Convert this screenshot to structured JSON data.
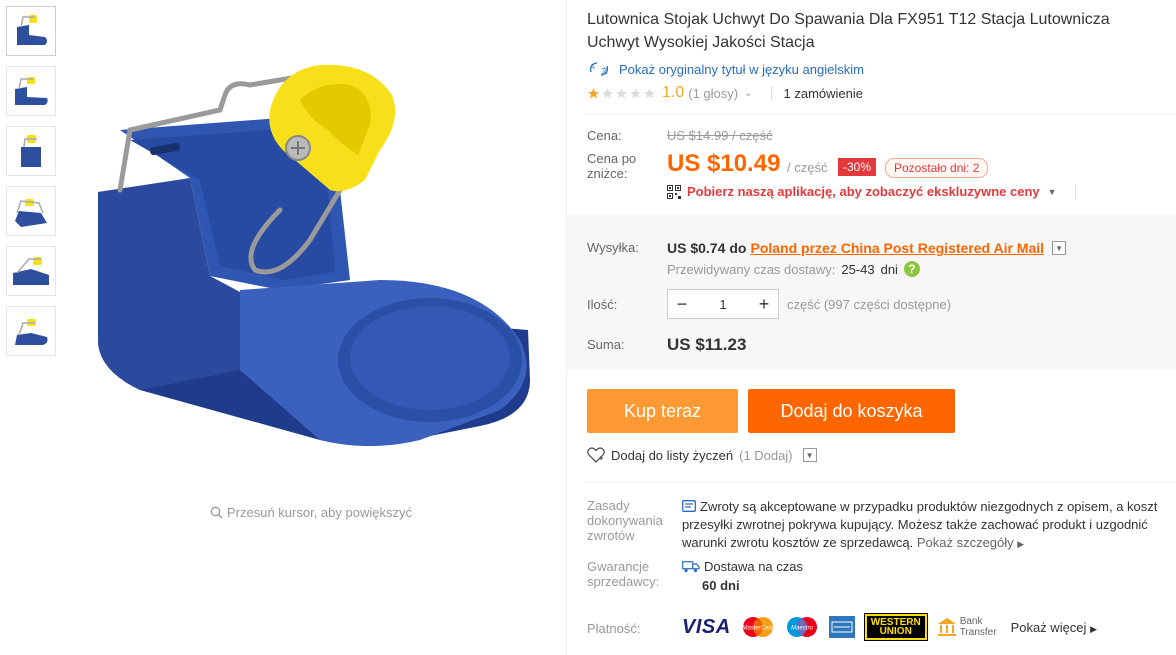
{
  "product": {
    "title": "Lutownica Stojak Uchwyt Do Spawania Dla FX951 T12 Stacja Lutownicza Uchwyt Wysokiej Jakości Stacja",
    "show_original_title": "Pokaż oryginalny tytuł w języku angielskim",
    "rating_value": "1.0",
    "votes": "(1 głosy)",
    "orders": "1 zamówienie",
    "stars_filled": 1,
    "stars_total": 5
  },
  "gallery": {
    "thumbnail_count": 6,
    "zoom_hint": "Przesuń kursor, aby powiększyć"
  },
  "price": {
    "label_price": "Cena:",
    "old_price": "US $14.99 / część",
    "label_discounted": "Cena po zniżce:",
    "new_price": "US $10.49",
    "per_unit": "/ część",
    "discount": "-30%",
    "remaining": "Pozostało dni: 2",
    "app_promo": "Pobierz naszą aplikację, aby zobaczyć ekskluzywne ceny"
  },
  "shipping": {
    "label": "Wysyłka:",
    "cost": "US $0.74",
    "to": "do",
    "method": "Poland przez China Post Registered Air Mail",
    "eta_label": "Przewidywany czas dostawy:",
    "eta_value": "25-43",
    "eta_unit": "dni"
  },
  "quantity": {
    "label": "Ilość:",
    "value": "1",
    "available": "część (997 części dostępne)"
  },
  "total": {
    "label": "Suma:",
    "value": "US $11.23"
  },
  "actions": {
    "buy_now": "Kup teraz",
    "add_to_cart": "Dodaj do koszyka",
    "wishlist": "Dodaj do listy życzeń",
    "wishlist_count": "(1 Dodaj)"
  },
  "policies": {
    "returns_label": "Zasady dokonywania zwrotów",
    "returns_text": "Zwroty są akceptowane w przypadku produktów niezgodnych z opisem, a koszt przesyłki zwrotnej pokrywa kupujący. Możesz także zachować produkt i uzgodnić warunki zwrotu kosztów ze sprzedawcą.",
    "returns_more": "Pokaż szczegóły",
    "guarantee_label": "Gwarancje sprzedawcy:",
    "guarantee_line1": "Dostawa na czas",
    "guarantee_line2": "60 dni",
    "payment_label": "Płatność:",
    "payment_visa": "VISA",
    "payment_mastercard": "MasterCard",
    "payment_maestro": "Maestro",
    "payment_western_top": "WESTERN",
    "payment_western_bottom": "UNION",
    "payment_bank_top": "Bank",
    "payment_bank_bottom": "Transfer",
    "payment_more": "Pokaż więcej"
  },
  "colors": {
    "accent_orange": "#ff6600",
    "buy_orange": "#ff9933",
    "discount_red": "#e4393c",
    "link_blue": "#2a6cbf",
    "product_blue": "#2d4f9e",
    "product_yellow": "#f7e01a"
  }
}
